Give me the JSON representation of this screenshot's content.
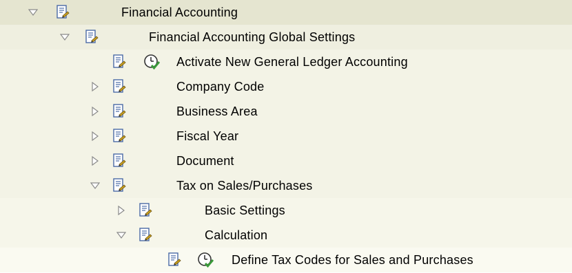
{
  "colors": {
    "level0_bg": "#e5e5d0",
    "level1_bg": "#efefe0",
    "level2_bg": "#f3f3e6",
    "level3_bg": "#f6f6ea",
    "level4_bg": "#fafaf1",
    "triangle": "#8a8a8a",
    "doc_blue": "#4a6aa6",
    "doc_gold": "#c8a020",
    "clock_green": "#3a9a3a"
  },
  "tree": [
    {
      "label": "Financial Accounting",
      "level": 0,
      "toggle": "expanded",
      "clock": false
    },
    {
      "label": "Financial Accounting Global Settings",
      "level": 1,
      "toggle": "expanded",
      "clock": false
    },
    {
      "label": "Activate New General Ledger Accounting",
      "level": 2,
      "toggle": "none",
      "clock": true
    },
    {
      "label": "Company Code",
      "level": 2,
      "toggle": "collapsed",
      "clock": false
    },
    {
      "label": "Business Area",
      "level": 2,
      "toggle": "collapsed",
      "clock": false
    },
    {
      "label": "Fiscal Year",
      "level": 2,
      "toggle": "collapsed",
      "clock": false
    },
    {
      "label": "Document",
      "level": 2,
      "toggle": "collapsed",
      "clock": false
    },
    {
      "label": "Tax on Sales/Purchases",
      "level": 2,
      "toggle": "expanded",
      "clock": false
    },
    {
      "label": "Basic Settings",
      "level": 3,
      "toggle": "collapsed",
      "clock": false
    },
    {
      "label": "Calculation",
      "level": 3,
      "toggle": "expanded",
      "clock": false
    },
    {
      "label": "Define Tax Codes for Sales and Purchases",
      "level": 4,
      "toggle": "none",
      "clock": true
    }
  ]
}
